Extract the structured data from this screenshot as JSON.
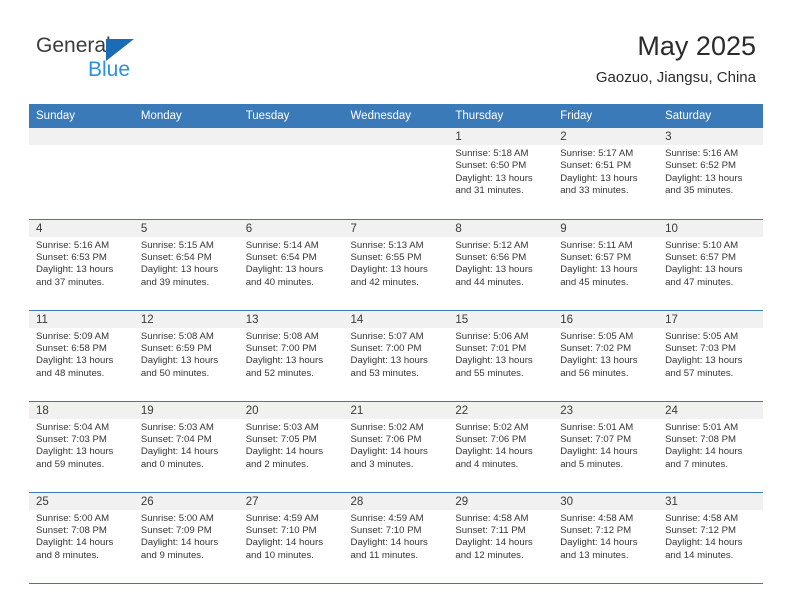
{
  "brand": {
    "name_part1": "General",
    "name_part2": "Blue",
    "logo_icon": "triangle-logo-icon",
    "accent_color": "#1b6cb5",
    "accent_color_light": "#2a92e0"
  },
  "header": {
    "title": "May 2025",
    "location": "Gaozuo, Jiangsu, China"
  },
  "calendar": {
    "header_bg": "#3b7ab8",
    "daynum_bg": "#f1f1f1",
    "weekdays": [
      "Sunday",
      "Monday",
      "Tuesday",
      "Wednesday",
      "Thursday",
      "Friday",
      "Saturday"
    ],
    "weeks": [
      [
        {
          "day": "",
          "sunrise": "",
          "sunset": "",
          "daylight_line1": "",
          "daylight_line2": ""
        },
        {
          "day": "",
          "sunrise": "",
          "sunset": "",
          "daylight_line1": "",
          "daylight_line2": ""
        },
        {
          "day": "",
          "sunrise": "",
          "sunset": "",
          "daylight_line1": "",
          "daylight_line2": ""
        },
        {
          "day": "",
          "sunrise": "",
          "sunset": "",
          "daylight_line1": "",
          "daylight_line2": ""
        },
        {
          "day": "1",
          "sunrise": "Sunrise: 5:18 AM",
          "sunset": "Sunset: 6:50 PM",
          "daylight_line1": "Daylight: 13 hours",
          "daylight_line2": "and 31 minutes."
        },
        {
          "day": "2",
          "sunrise": "Sunrise: 5:17 AM",
          "sunset": "Sunset: 6:51 PM",
          "daylight_line1": "Daylight: 13 hours",
          "daylight_line2": "and 33 minutes."
        },
        {
          "day": "3",
          "sunrise": "Sunrise: 5:16 AM",
          "sunset": "Sunset: 6:52 PM",
          "daylight_line1": "Daylight: 13 hours",
          "daylight_line2": "and 35 minutes."
        }
      ],
      [
        {
          "day": "4",
          "sunrise": "Sunrise: 5:16 AM",
          "sunset": "Sunset: 6:53 PM",
          "daylight_line1": "Daylight: 13 hours",
          "daylight_line2": "and 37 minutes."
        },
        {
          "day": "5",
          "sunrise": "Sunrise: 5:15 AM",
          "sunset": "Sunset: 6:54 PM",
          "daylight_line1": "Daylight: 13 hours",
          "daylight_line2": "and 39 minutes."
        },
        {
          "day": "6",
          "sunrise": "Sunrise: 5:14 AM",
          "sunset": "Sunset: 6:54 PM",
          "daylight_line1": "Daylight: 13 hours",
          "daylight_line2": "and 40 minutes."
        },
        {
          "day": "7",
          "sunrise": "Sunrise: 5:13 AM",
          "sunset": "Sunset: 6:55 PM",
          "daylight_line1": "Daylight: 13 hours",
          "daylight_line2": "and 42 minutes."
        },
        {
          "day": "8",
          "sunrise": "Sunrise: 5:12 AM",
          "sunset": "Sunset: 6:56 PM",
          "daylight_line1": "Daylight: 13 hours",
          "daylight_line2": "and 44 minutes."
        },
        {
          "day": "9",
          "sunrise": "Sunrise: 5:11 AM",
          "sunset": "Sunset: 6:57 PM",
          "daylight_line1": "Daylight: 13 hours",
          "daylight_line2": "and 45 minutes."
        },
        {
          "day": "10",
          "sunrise": "Sunrise: 5:10 AM",
          "sunset": "Sunset: 6:57 PM",
          "daylight_line1": "Daylight: 13 hours",
          "daylight_line2": "and 47 minutes."
        }
      ],
      [
        {
          "day": "11",
          "sunrise": "Sunrise: 5:09 AM",
          "sunset": "Sunset: 6:58 PM",
          "daylight_line1": "Daylight: 13 hours",
          "daylight_line2": "and 48 minutes."
        },
        {
          "day": "12",
          "sunrise": "Sunrise: 5:08 AM",
          "sunset": "Sunset: 6:59 PM",
          "daylight_line1": "Daylight: 13 hours",
          "daylight_line2": "and 50 minutes."
        },
        {
          "day": "13",
          "sunrise": "Sunrise: 5:08 AM",
          "sunset": "Sunset: 7:00 PM",
          "daylight_line1": "Daylight: 13 hours",
          "daylight_line2": "and 52 minutes."
        },
        {
          "day": "14",
          "sunrise": "Sunrise: 5:07 AM",
          "sunset": "Sunset: 7:00 PM",
          "daylight_line1": "Daylight: 13 hours",
          "daylight_line2": "and 53 minutes."
        },
        {
          "day": "15",
          "sunrise": "Sunrise: 5:06 AM",
          "sunset": "Sunset: 7:01 PM",
          "daylight_line1": "Daylight: 13 hours",
          "daylight_line2": "and 55 minutes."
        },
        {
          "day": "16",
          "sunrise": "Sunrise: 5:05 AM",
          "sunset": "Sunset: 7:02 PM",
          "daylight_line1": "Daylight: 13 hours",
          "daylight_line2": "and 56 minutes."
        },
        {
          "day": "17",
          "sunrise": "Sunrise: 5:05 AM",
          "sunset": "Sunset: 7:03 PM",
          "daylight_line1": "Daylight: 13 hours",
          "daylight_line2": "and 57 minutes."
        }
      ],
      [
        {
          "day": "18",
          "sunrise": "Sunrise: 5:04 AM",
          "sunset": "Sunset: 7:03 PM",
          "daylight_line1": "Daylight: 13 hours",
          "daylight_line2": "and 59 minutes."
        },
        {
          "day": "19",
          "sunrise": "Sunrise: 5:03 AM",
          "sunset": "Sunset: 7:04 PM",
          "daylight_line1": "Daylight: 14 hours",
          "daylight_line2": "and 0 minutes."
        },
        {
          "day": "20",
          "sunrise": "Sunrise: 5:03 AM",
          "sunset": "Sunset: 7:05 PM",
          "daylight_line1": "Daylight: 14 hours",
          "daylight_line2": "and 2 minutes."
        },
        {
          "day": "21",
          "sunrise": "Sunrise: 5:02 AM",
          "sunset": "Sunset: 7:06 PM",
          "daylight_line1": "Daylight: 14 hours",
          "daylight_line2": "and 3 minutes."
        },
        {
          "day": "22",
          "sunrise": "Sunrise: 5:02 AM",
          "sunset": "Sunset: 7:06 PM",
          "daylight_line1": "Daylight: 14 hours",
          "daylight_line2": "and 4 minutes."
        },
        {
          "day": "23",
          "sunrise": "Sunrise: 5:01 AM",
          "sunset": "Sunset: 7:07 PM",
          "daylight_line1": "Daylight: 14 hours",
          "daylight_line2": "and 5 minutes."
        },
        {
          "day": "24",
          "sunrise": "Sunrise: 5:01 AM",
          "sunset": "Sunset: 7:08 PM",
          "daylight_line1": "Daylight: 14 hours",
          "daylight_line2": "and 7 minutes."
        }
      ],
      [
        {
          "day": "25",
          "sunrise": "Sunrise: 5:00 AM",
          "sunset": "Sunset: 7:08 PM",
          "daylight_line1": "Daylight: 14 hours",
          "daylight_line2": "and 8 minutes."
        },
        {
          "day": "26",
          "sunrise": "Sunrise: 5:00 AM",
          "sunset": "Sunset: 7:09 PM",
          "daylight_line1": "Daylight: 14 hours",
          "daylight_line2": "and 9 minutes."
        },
        {
          "day": "27",
          "sunrise": "Sunrise: 4:59 AM",
          "sunset": "Sunset: 7:10 PM",
          "daylight_line1": "Daylight: 14 hours",
          "daylight_line2": "and 10 minutes."
        },
        {
          "day": "28",
          "sunrise": "Sunrise: 4:59 AM",
          "sunset": "Sunset: 7:10 PM",
          "daylight_line1": "Daylight: 14 hours",
          "daylight_line2": "and 11 minutes."
        },
        {
          "day": "29",
          "sunrise": "Sunrise: 4:58 AM",
          "sunset": "Sunset: 7:11 PM",
          "daylight_line1": "Daylight: 14 hours",
          "daylight_line2": "and 12 minutes."
        },
        {
          "day": "30",
          "sunrise": "Sunrise: 4:58 AM",
          "sunset": "Sunset: 7:12 PM",
          "daylight_line1": "Daylight: 14 hours",
          "daylight_line2": "and 13 minutes."
        },
        {
          "day": "31",
          "sunrise": "Sunrise: 4:58 AM",
          "sunset": "Sunset: 7:12 PM",
          "daylight_line1": "Daylight: 14 hours",
          "daylight_line2": "and 14 minutes."
        }
      ]
    ]
  }
}
